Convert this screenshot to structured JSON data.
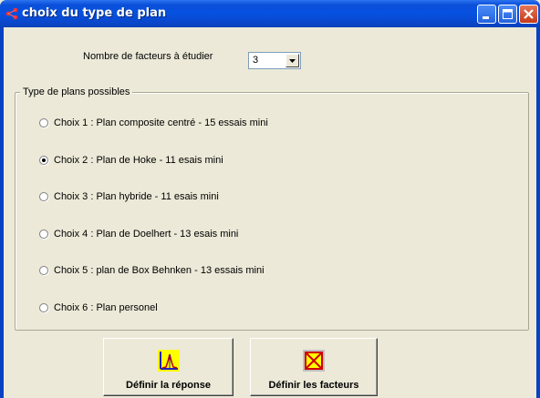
{
  "window": {
    "title": "choix du type de plan",
    "buttons": [
      "minimize-icon",
      "maximize-icon",
      "close-icon"
    ]
  },
  "factors": {
    "label": "Nombre de facteurs à étudier",
    "value": "3"
  },
  "group": {
    "label": "Type de plans possibles",
    "options": [
      {
        "label": "Choix 1 : Plan composite centré - 15 essais mini",
        "selected": false
      },
      {
        "label": "Choix 2 : Plan de Hoke - 11 esais mini",
        "selected": true
      },
      {
        "label": "Choix 3 : Plan hybride - 11 esais mini",
        "selected": false
      },
      {
        "label": "Choix 4 : Plan de Doelhert - 13 esais mini",
        "selected": false
      },
      {
        "label": "Choix 5 : plan de Box Behnken - 13 essais mini",
        "selected": false
      },
      {
        "label": "Choix 6 : Plan personel",
        "selected": false
      }
    ]
  },
  "actions": {
    "response_label": "Définir la réponse",
    "response_icon": "response-curve-icon",
    "factors_label": "Définir les facteurs",
    "factors_icon": "factors-cross-icon"
  },
  "colors": {
    "titlebar": "#0651e0",
    "face": "#ece9d8"
  }
}
